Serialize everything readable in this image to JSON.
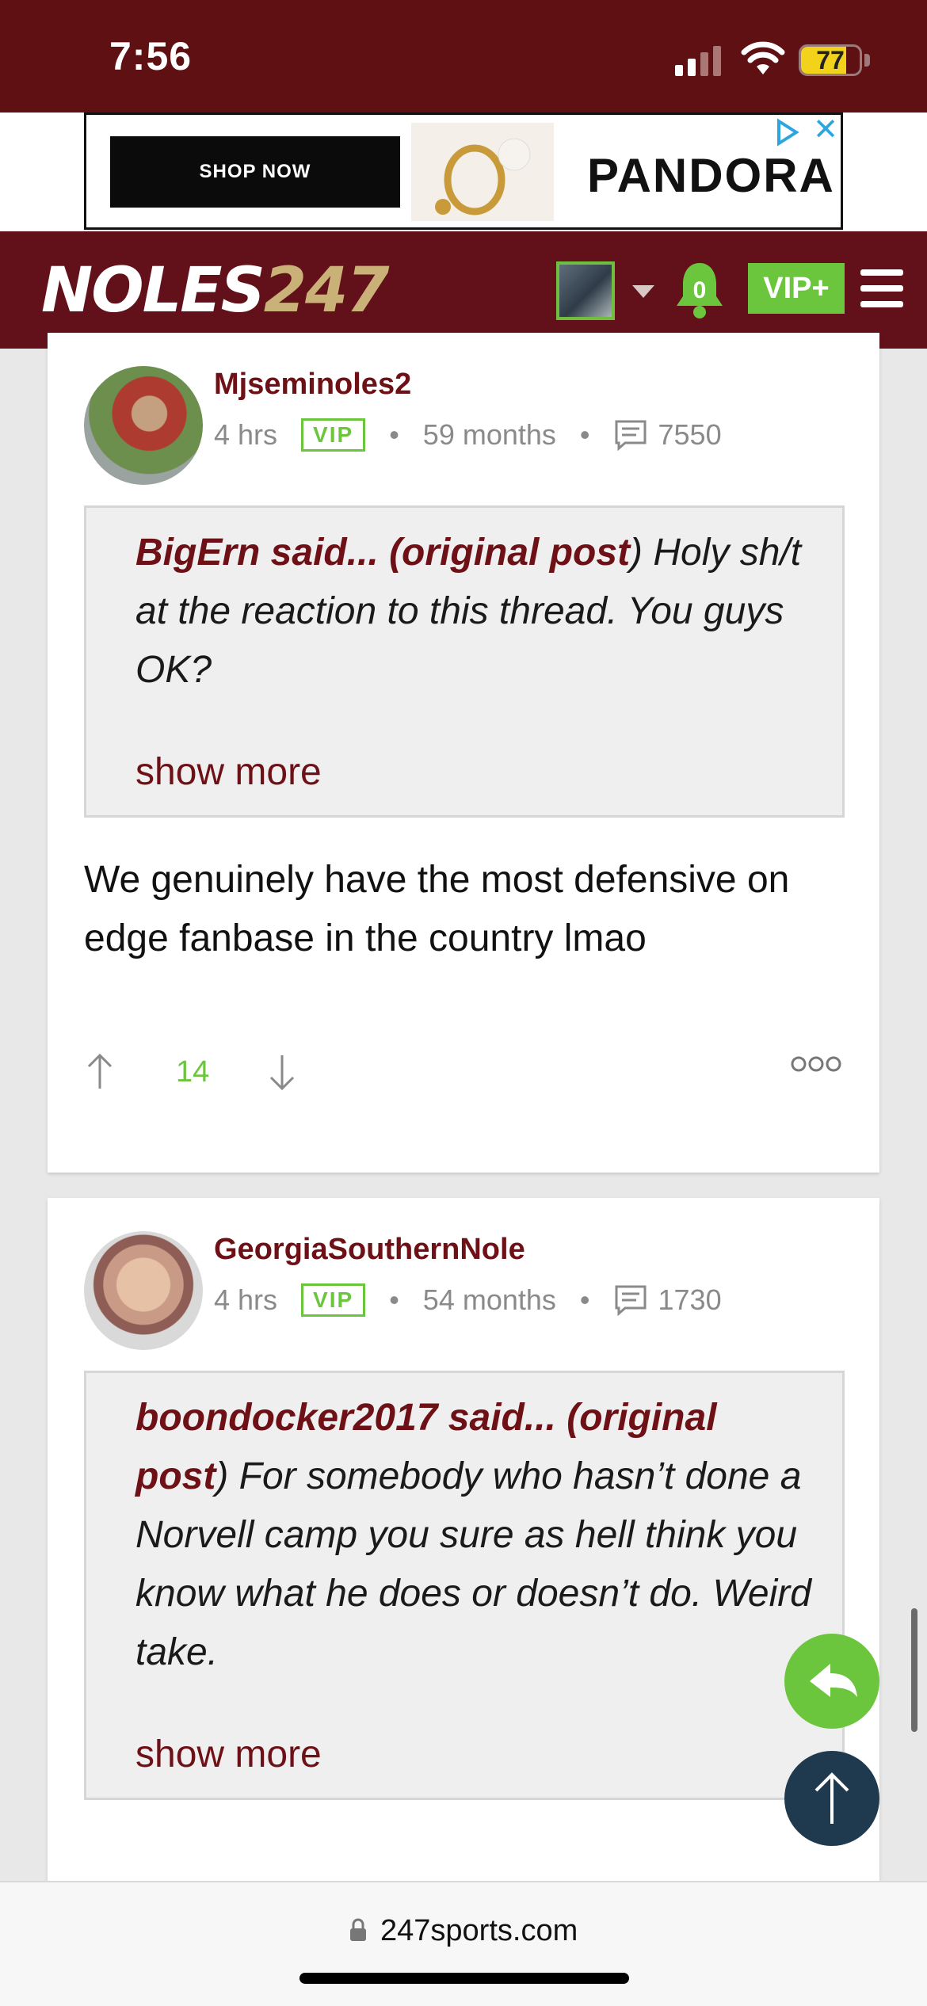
{
  "status_bar": {
    "time": "7:56",
    "battery": "77",
    "battery_level": 0.77
  },
  "ad": {
    "cta": "SHOP NOW",
    "brand": "PANDORA"
  },
  "header": {
    "logo_text": "NOLES",
    "logo_num": "247",
    "notification_count": "0",
    "vip_label": "VIP+"
  },
  "posts": [
    {
      "username": "Mjseminoles2",
      "time": "4 hrs",
      "badge": "VIP",
      "tenure": "59 months",
      "post_count": "7550",
      "quote_author": "BigErn said... (",
      "quote_link": "original post",
      "quote_tail": ")",
      "quote_body": " Holy sh/t at the reaction to this thread. You guys OK?",
      "show_more": "show more",
      "body": "We genuinely have the most defensive on edge fanbase in the country lmao",
      "votes": "14"
    },
    {
      "username": "GeorgiaSouthernNole",
      "time": "4 hrs",
      "badge": "VIP",
      "tenure": "54 months",
      "post_count": "1730",
      "quote_author": "boondocker2017 said... (",
      "quote_link": "original post",
      "quote_tail": ")",
      "quote_body": " For somebody who hasn’t done a Norvell camp you sure as hell think you know what he does or doesn’t do. Weird take.",
      "show_more": "show more"
    }
  ],
  "url_bar": {
    "url": "247sports.com"
  },
  "icons": {
    "signal": "signal-icon",
    "wifi": "wifi-icon",
    "bell": "bell-icon",
    "menu": "hamburger-menu-icon",
    "reply": "reply-icon",
    "scroll_top": "arrow-up-icon",
    "lock": "lock-icon",
    "posts": "message-icon",
    "upvote": "arrow-up-icon",
    "downvote": "arrow-down-icon",
    "more": "more-options-icon"
  },
  "colors": {
    "header": "#62111a",
    "status": "#5f1012",
    "accent_green": "#6cc63d",
    "username": "#6e1117"
  }
}
